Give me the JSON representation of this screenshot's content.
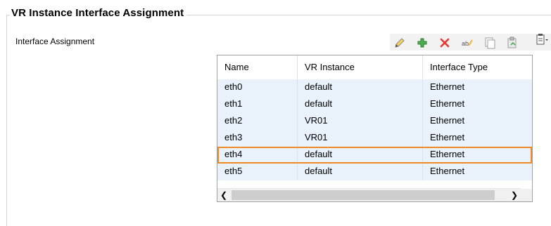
{
  "group": {
    "title": "VR Instance Interface Assignment"
  },
  "section": {
    "label": "Interface Assignment"
  },
  "toolbar": {
    "buttons": [
      {
        "icon": "pencil-icon"
      },
      {
        "icon": "plus-icon"
      },
      {
        "icon": "delete-icon"
      },
      {
        "icon": "rename-icon"
      },
      {
        "icon": "copy-icon"
      },
      {
        "icon": "paste-icon"
      },
      {
        "icon": "clipboard-menu-icon"
      }
    ]
  },
  "grid": {
    "columns": [
      "Name",
      "VR Instance",
      "Interface Type"
    ],
    "rows": [
      {
        "name": "eth0",
        "vr": "default",
        "type": "Ethernet"
      },
      {
        "name": "eth1",
        "vr": "default",
        "type": "Ethernet"
      },
      {
        "name": "eth2",
        "vr": "VR01",
        "type": "Ethernet"
      },
      {
        "name": "eth3",
        "vr": "VR01",
        "type": "Ethernet"
      },
      {
        "name": "eth4",
        "vr": "default",
        "type": "Ethernet",
        "selected": true
      },
      {
        "name": "eth5",
        "vr": "default",
        "type": "Ethernet"
      }
    ]
  },
  "colors": {
    "row_bg": "#e9f1fb",
    "selection": "#f08a24",
    "toolbar_bg": "#f2f2f2"
  }
}
